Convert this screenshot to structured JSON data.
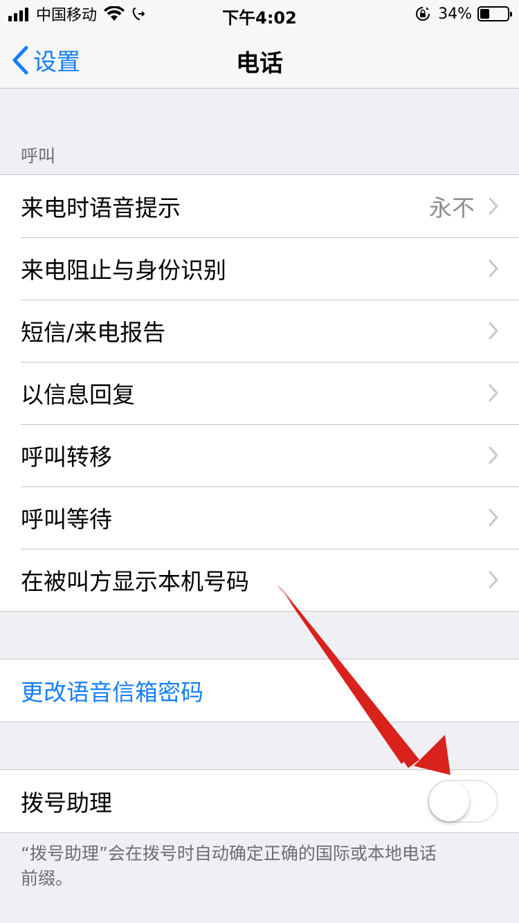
{
  "status_bar": {
    "carrier": "中国移动",
    "time": "下午4:02",
    "battery_percent_label": "34%",
    "battery_level": 0.34
  },
  "nav": {
    "back_label": "设置",
    "title": "电话"
  },
  "calls_section": {
    "header": "呼叫",
    "items": [
      {
        "label": "来电时语音提示",
        "detail": "永不"
      },
      {
        "label": "来电阻止与身份识别"
      },
      {
        "label": "短信/来电报告"
      },
      {
        "label": "以信息回复"
      },
      {
        "label": "呼叫转移"
      },
      {
        "label": "呼叫等待"
      },
      {
        "label": "在被叫方显示本机号码"
      }
    ]
  },
  "voicemail": {
    "change_password_label": "更改语音信箱密码"
  },
  "dial_assist": {
    "label": "拨号助理",
    "enabled": false,
    "footer": "“拨号助理”会在拨号时自动确定正确的国际或本地电话前缀。"
  },
  "colors": {
    "accent": "#147efb",
    "annotation_arrow": "#d9221c",
    "background": "#efeff4"
  }
}
